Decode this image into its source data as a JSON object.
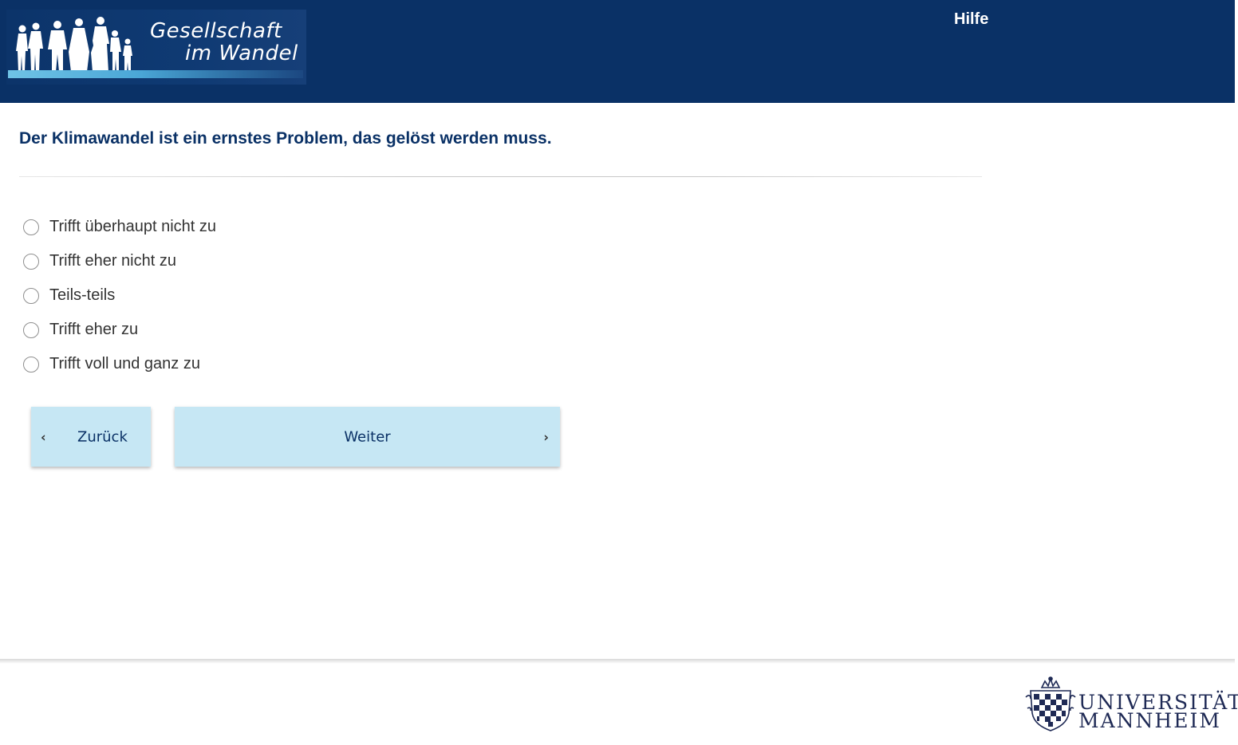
{
  "header": {
    "logo": {
      "line1": "Gesellschaft",
      "line2": "im Wandel"
    },
    "help_label": "Hilfe"
  },
  "question": {
    "text": "Der Klimawandel ist ein ernstes Problem, das gelöst werden muss.",
    "options": [
      {
        "label": "Trifft überhaupt nicht zu",
        "selected": false
      },
      {
        "label": "Trifft eher nicht zu",
        "selected": false
      },
      {
        "label": "Teils-teils",
        "selected": false
      },
      {
        "label": "Trifft eher zu",
        "selected": false
      },
      {
        "label": "Trifft voll und ganz zu",
        "selected": false
      }
    ]
  },
  "navigation": {
    "back_label": "Zurück",
    "next_label": "Weiter",
    "back_icon": "chevron-left-icon",
    "next_icon": "chevron-right-icon"
  },
  "footer": {
    "university": {
      "line1": "UNIVERSITÄT",
      "line2": "MANNHEIM"
    }
  },
  "colors": {
    "header_bg": "#0a3166",
    "question_text": "#0a3166",
    "button_bg": "#c6e7f4",
    "logo_accent": "#6fc3e6"
  }
}
